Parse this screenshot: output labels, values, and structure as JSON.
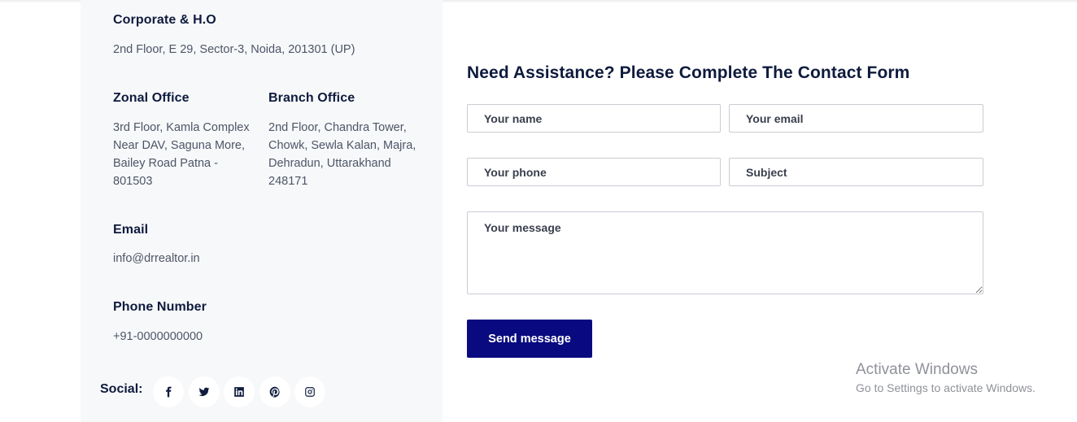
{
  "offices": {
    "corporate": {
      "title": "Corporate & H.O",
      "address": "2nd Floor, E 29, Sector-3, Noida, 201301 (UP)"
    },
    "zonal": {
      "title": "Zonal Office",
      "lines": [
        "3rd Floor, Kamla Complex",
        "Near DAV, Saguna More,",
        "Bailey Road Patna -",
        "801503"
      ]
    },
    "branch": {
      "title": "Branch Office",
      "lines": [
        "2nd Floor, Chandra Tower,",
        "Chowk, Sewla Kalan, Majra,",
        "Dehradun, Uttarakhand",
        "248171"
      ]
    }
  },
  "email": {
    "title": "Email",
    "value": "info@drrealtor.in"
  },
  "phone": {
    "title": "Phone Number",
    "value": "+91-0000000000"
  },
  "social": {
    "label": "Social:",
    "icons": [
      "facebook-icon",
      "twitter-icon",
      "linkedin-icon",
      "pinterest-icon",
      "instagram-icon"
    ]
  },
  "form": {
    "title": "Need Assistance? Please Complete The Contact Form",
    "name_placeholder": "Your name",
    "email_placeholder": "Your email",
    "phone_placeholder": "Your phone",
    "subject_placeholder": "Subject",
    "message_placeholder": "Your message",
    "submit_label": "Send message"
  },
  "watermark": {
    "title": "Activate Windows",
    "subtitle": "Go to Settings to activate Windows."
  },
  "colors": {
    "panel_bg": "#f7f8fa",
    "heading": "#0e1b3d",
    "body_text": "#4d5566",
    "button_bg": "#0a0a80"
  }
}
